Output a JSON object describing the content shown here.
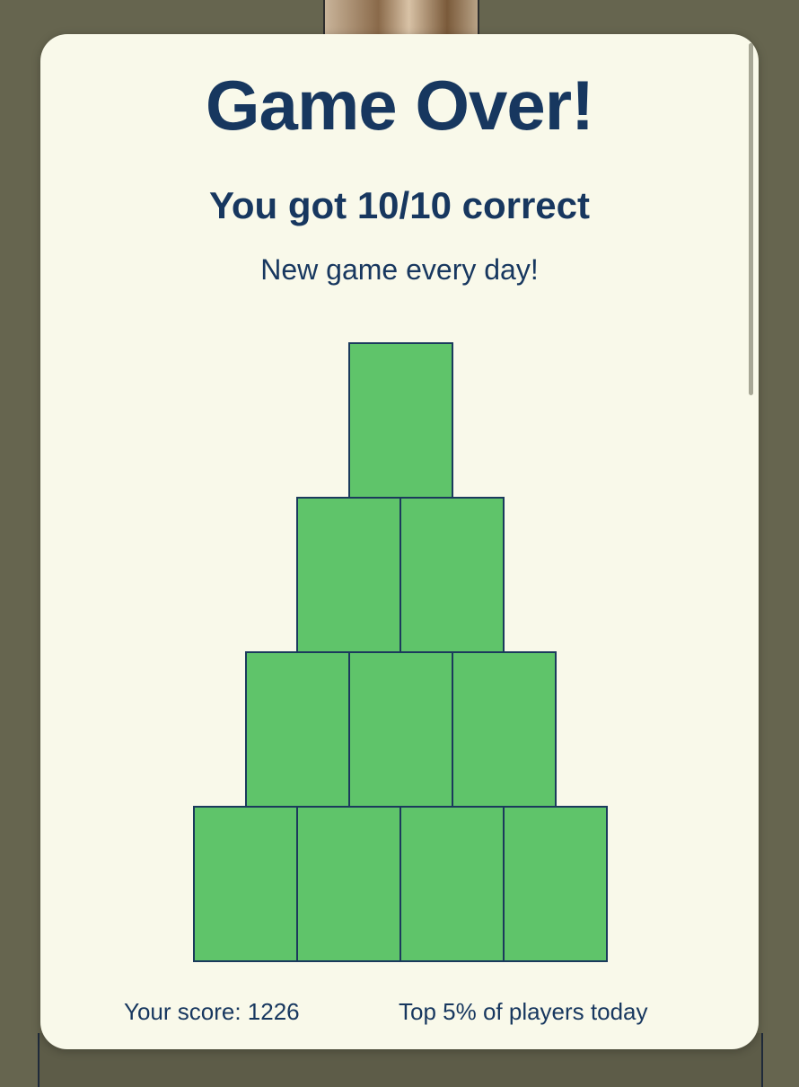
{
  "game": {
    "title": "Game Over!",
    "result": "You got 10/10 correct",
    "tagline": "New game every day!",
    "score_text": "Your score: 1226",
    "rank_text": "Top 5% of players today"
  },
  "tiles": {
    "rows": [
      1,
      2,
      3,
      4
    ],
    "correct": 10,
    "total": 10,
    "color_correct": "#5fc46a",
    "border_color": "#1b3a5c"
  },
  "colors": {
    "card_background": "#f9f9ea",
    "text": "#17375f",
    "page_background": "#66654f"
  }
}
